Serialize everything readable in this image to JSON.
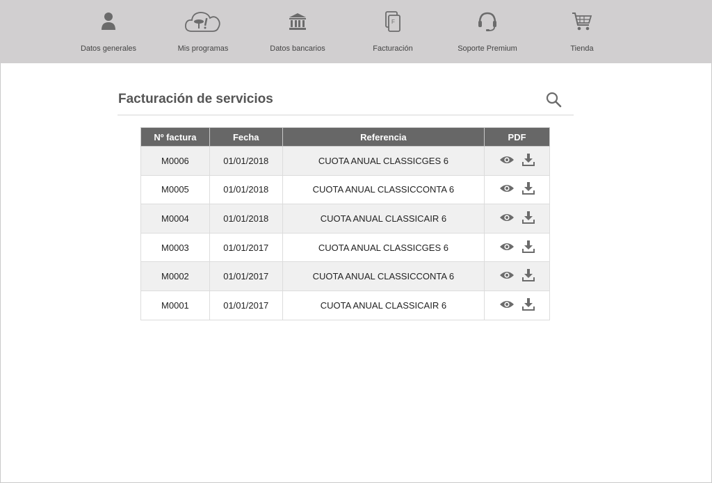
{
  "nav": {
    "items": [
      {
        "label": "Datos generales",
        "icon": "user-icon"
      },
      {
        "label": "Mis programas",
        "icon": "cloud-icon"
      },
      {
        "label": "Datos bancarios",
        "icon": "bank-icon"
      },
      {
        "label": "Facturación",
        "icon": "invoice-icon"
      },
      {
        "label": "Soporte Premium",
        "icon": "headset-icon"
      },
      {
        "label": "Tienda",
        "icon": "cart-icon"
      }
    ]
  },
  "main": {
    "title": "Facturación de servicios",
    "search_icon": "search-icon"
  },
  "table": {
    "headers": [
      "Nº factura",
      "Fecha",
      "Referencia",
      "PDF"
    ],
    "rows": [
      {
        "number": "M0006",
        "date": "01/01/2018",
        "reference": "CUOTA ANUAL CLASSICGES 6"
      },
      {
        "number": "M0005",
        "date": "01/01/2018",
        "reference": "CUOTA ANUAL CLASSICCONTA 6"
      },
      {
        "number": "M0004",
        "date": "01/01/2018",
        "reference": "CUOTA ANUAL CLASSICAIR 6"
      },
      {
        "number": "M0003",
        "date": "01/01/2017",
        "reference": "CUOTA ANUAL CLASSICGES 6"
      },
      {
        "number": "M0002",
        "date": "01/01/2017",
        "reference": "CUOTA ANUAL CLASSICCONTA 6"
      },
      {
        "number": "M0001",
        "date": "01/01/2017",
        "reference": "CUOTA ANUAL CLASSICAIR 6"
      }
    ],
    "pdf_icons": [
      "eye-icon",
      "download-icon"
    ]
  },
  "colors": {
    "nav_bg": "#d1cfd0",
    "icon": "#6b6b6b",
    "header_bg": "#676767",
    "row_alt": "#f0f0f0"
  }
}
